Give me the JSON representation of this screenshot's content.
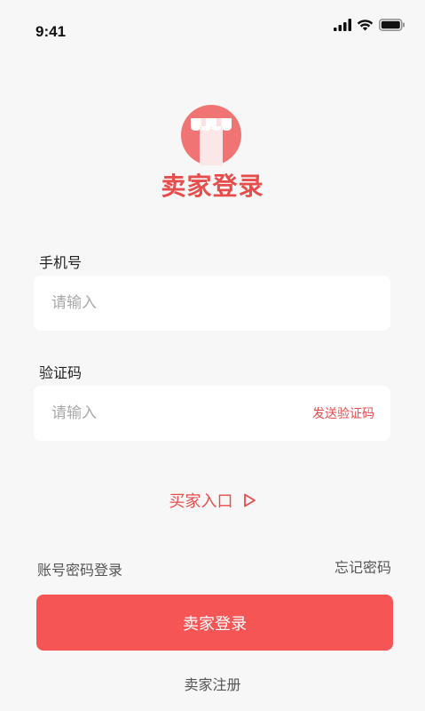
{
  "status_bar": {
    "time": "9:41"
  },
  "brand": {
    "title": "卖家登录",
    "accent_color": "#e84d4d",
    "button_color": "#f65555"
  },
  "form": {
    "phone": {
      "label": "手机号",
      "placeholder": "请输入"
    },
    "code": {
      "label": "验证码",
      "placeholder": "请输入",
      "send_label": "发送验证码"
    }
  },
  "links": {
    "buyer_entry": "买家入口",
    "buyer_entry_icon": "play-triangle-icon",
    "password_login": "账号密码登录",
    "forgot_password": "忘记密码",
    "register": "卖家注册"
  },
  "login_button": {
    "label": "卖家登录"
  }
}
